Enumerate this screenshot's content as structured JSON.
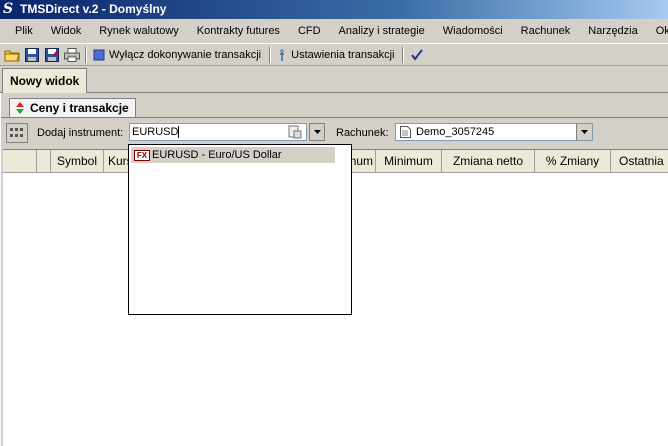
{
  "window": {
    "title": "TMSDirect v.2 - Domyślny",
    "app_icon_glyph": "S"
  },
  "menu": [
    "Plik",
    "Widok",
    "Rynek walutowy",
    "Kontrakty futures",
    "CFD",
    "Analizy i strategie",
    "Wiadomości",
    "Rachunek",
    "Narzędzia",
    "Okno"
  ],
  "toolbar": {
    "icons": [
      "open-folder-icon",
      "save-icon",
      "save-all-icon",
      "print-icon"
    ],
    "disable_trading": "Wyłącz dokonywanie transakcji",
    "trade_settings": "Ustawienia transakcji"
  },
  "views": {
    "active_tab": "Nowy widok"
  },
  "panel": {
    "subtab": "Ceny i transakcje",
    "add_instrument_label": "Dodaj instrument:",
    "instrument_value": "EURUSD",
    "account_label": "Rachunek:",
    "account_value": "Demo_3057245"
  },
  "table": {
    "columns": [
      "",
      "Symbol",
      "Kurs",
      "",
      "",
      "mum",
      "Minimum",
      "Zmiana netto",
      "% Zmiany",
      "Ostatnia"
    ]
  },
  "autocomplete": {
    "items": [
      {
        "badge": "FX",
        "label": "EURUSD - Euro/US Dollar",
        "highlighted": true
      }
    ]
  },
  "colors": {
    "title_start": "#0a246a",
    "title_end": "#a6caf0",
    "window_bg": "#d4d0c8"
  }
}
